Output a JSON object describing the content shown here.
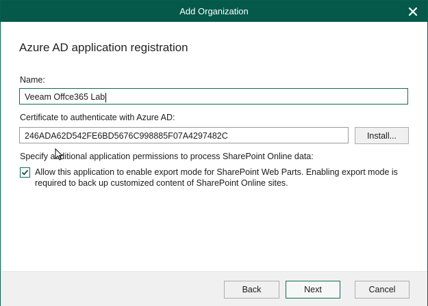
{
  "window": {
    "title": "Add Organization"
  },
  "page": {
    "heading": "Azure AD application registration"
  },
  "name_field": {
    "label": "Name:",
    "value": "Veeam Offce365 Lab"
  },
  "certificate_field": {
    "label": "Certificate to authenticate with Azure AD:",
    "value": "246ADA62D542FE6BD5676C998885F07A4297482C",
    "install_label": "Install..."
  },
  "permissions": {
    "label": "Specify additional application permissions to process SharePoint Online data:",
    "checkbox_checked": true,
    "checkbox_text": "Allow this application to enable export mode for SharePoint Web Parts. Enabling export mode is required to back up customized content of SharePoint Online sites."
  },
  "footer": {
    "back_label": "Back",
    "next_label": "Next",
    "cancel_label": "Cancel"
  },
  "colors": {
    "titlebar": "#04594a",
    "accent": "#0b6c57"
  },
  "icons": {
    "close": "close-icon",
    "check": "checkmark-icon",
    "cursor": "mouse-pointer-icon"
  }
}
